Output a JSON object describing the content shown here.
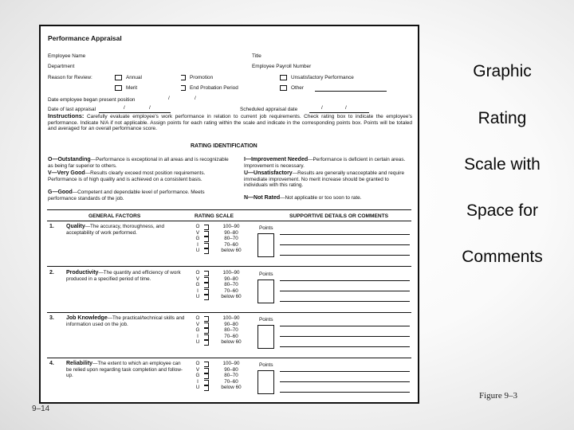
{
  "slide": {
    "side_title_lines": [
      "Graphic",
      "Rating",
      "Scale with",
      "Space for",
      "Comments"
    ],
    "figure_caption": "Figure 9–3",
    "page_number": "9–14"
  },
  "form": {
    "title": "Performance Appraisal",
    "fields": {
      "employee_name": "Employee Name",
      "title": "Title",
      "department": "Department",
      "payroll_number": "Employee Payroll Number",
      "reason_label": "Reason for Review:",
      "date_began": "Date employee began present position",
      "date_last": "Date of last appraisal",
      "scheduled": "Scheduled appraisal date",
      "date_sep": "/"
    },
    "reasons": [
      {
        "label": "Annual",
        "checked": false
      },
      {
        "label": "Merit",
        "checked": false
      },
      {
        "label": "Promotion",
        "checked": false
      },
      {
        "label": "End Probation Period",
        "checked": false
      },
      {
        "label": "Unsatisfactory Performance",
        "checked": false
      },
      {
        "label": "Other",
        "checked": false
      }
    ],
    "instructions_label": "Instructions:",
    "instructions_text": " Carefully evaluate employee's work performance in relation to current job requirements. Check rating box to indicate the employee's performance. Indicate N/A if not applicable. Assign points for each rating within the scale and indicate in the corresponding points box. Points will be totaled and averaged for an overall performance score.",
    "rating_identification_heading": "RATING IDENTIFICATION",
    "ratings": [
      {
        "key": "O—Outstanding",
        "desc": "—Performance is exceptional in all areas and is recognizable as being far superior to others."
      },
      {
        "key": "V—Very Good",
        "desc": "—Results clearly exceed most position requirements. Performance is of high quality and is achieved on a consistent basis."
      },
      {
        "key": "G—Good",
        "desc": "—Competent and dependable level of performance. Meets performance standards of the job."
      },
      {
        "key": "I—Improvement Needed",
        "desc": "—Performance is deficient in certain areas. Improvement is necessary."
      },
      {
        "key": "U—Unsatisfactory",
        "desc": "—Results are generally unacceptable and require immediate improvement. No merit increase should be granted to individuals with this rating."
      },
      {
        "key": "N—Not Rated",
        "desc": "—Not applicable or too soon to rate."
      }
    ],
    "columns": {
      "general_factors": "GENERAL FACTORS",
      "rating_scale": "RATING SCALE",
      "comments": "SUPPORTIVE DETAILS OR COMMENTS"
    },
    "points_label": "Points",
    "scale": [
      {
        "letter": "O",
        "range": "100–90"
      },
      {
        "letter": "V",
        "range": "90–80"
      },
      {
        "letter": "G",
        "range": "80–70"
      },
      {
        "letter": "I",
        "range": "70–60"
      },
      {
        "letter": "U",
        "range": "below 60"
      }
    ],
    "factors": [
      {
        "num": "1.",
        "name": "Quality",
        "desc": "—The accuracy, thoroughness, and acceptability of work performed."
      },
      {
        "num": "2.",
        "name": "Productivity",
        "desc": "—The quantity and efficiency of work produced in a specified period of time."
      },
      {
        "num": "3.",
        "name": "Job Knowledge",
        "desc": "—The practical/technical skills and information used on the job."
      },
      {
        "num": "4.",
        "name": "Reliability",
        "desc": "—The extent to which an employee can be relied upon regarding task completion and follow-up."
      }
    ]
  }
}
